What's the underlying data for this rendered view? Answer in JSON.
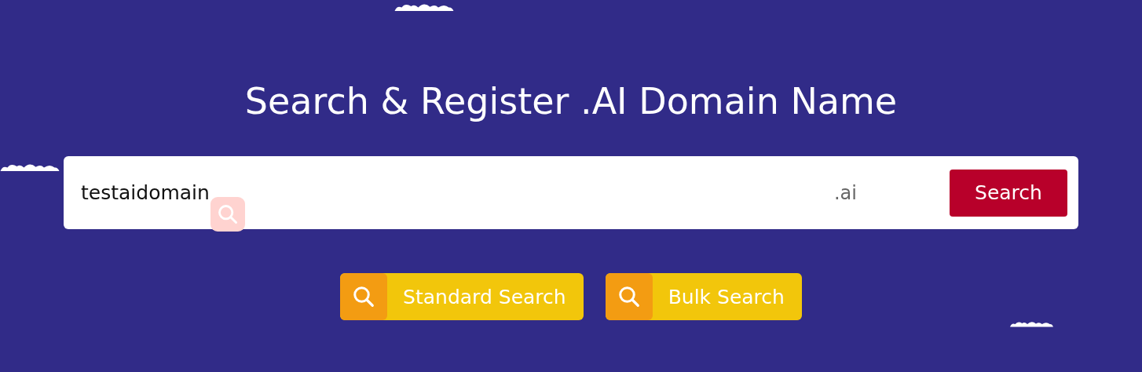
{
  "title": "Search & Register .AI Domain Name",
  "search": {
    "value": "testaidomain",
    "suffix": ".ai",
    "button": "Search"
  },
  "modes": [
    {
      "label": "Standard Search"
    },
    {
      "label": "Bulk Search"
    }
  ]
}
